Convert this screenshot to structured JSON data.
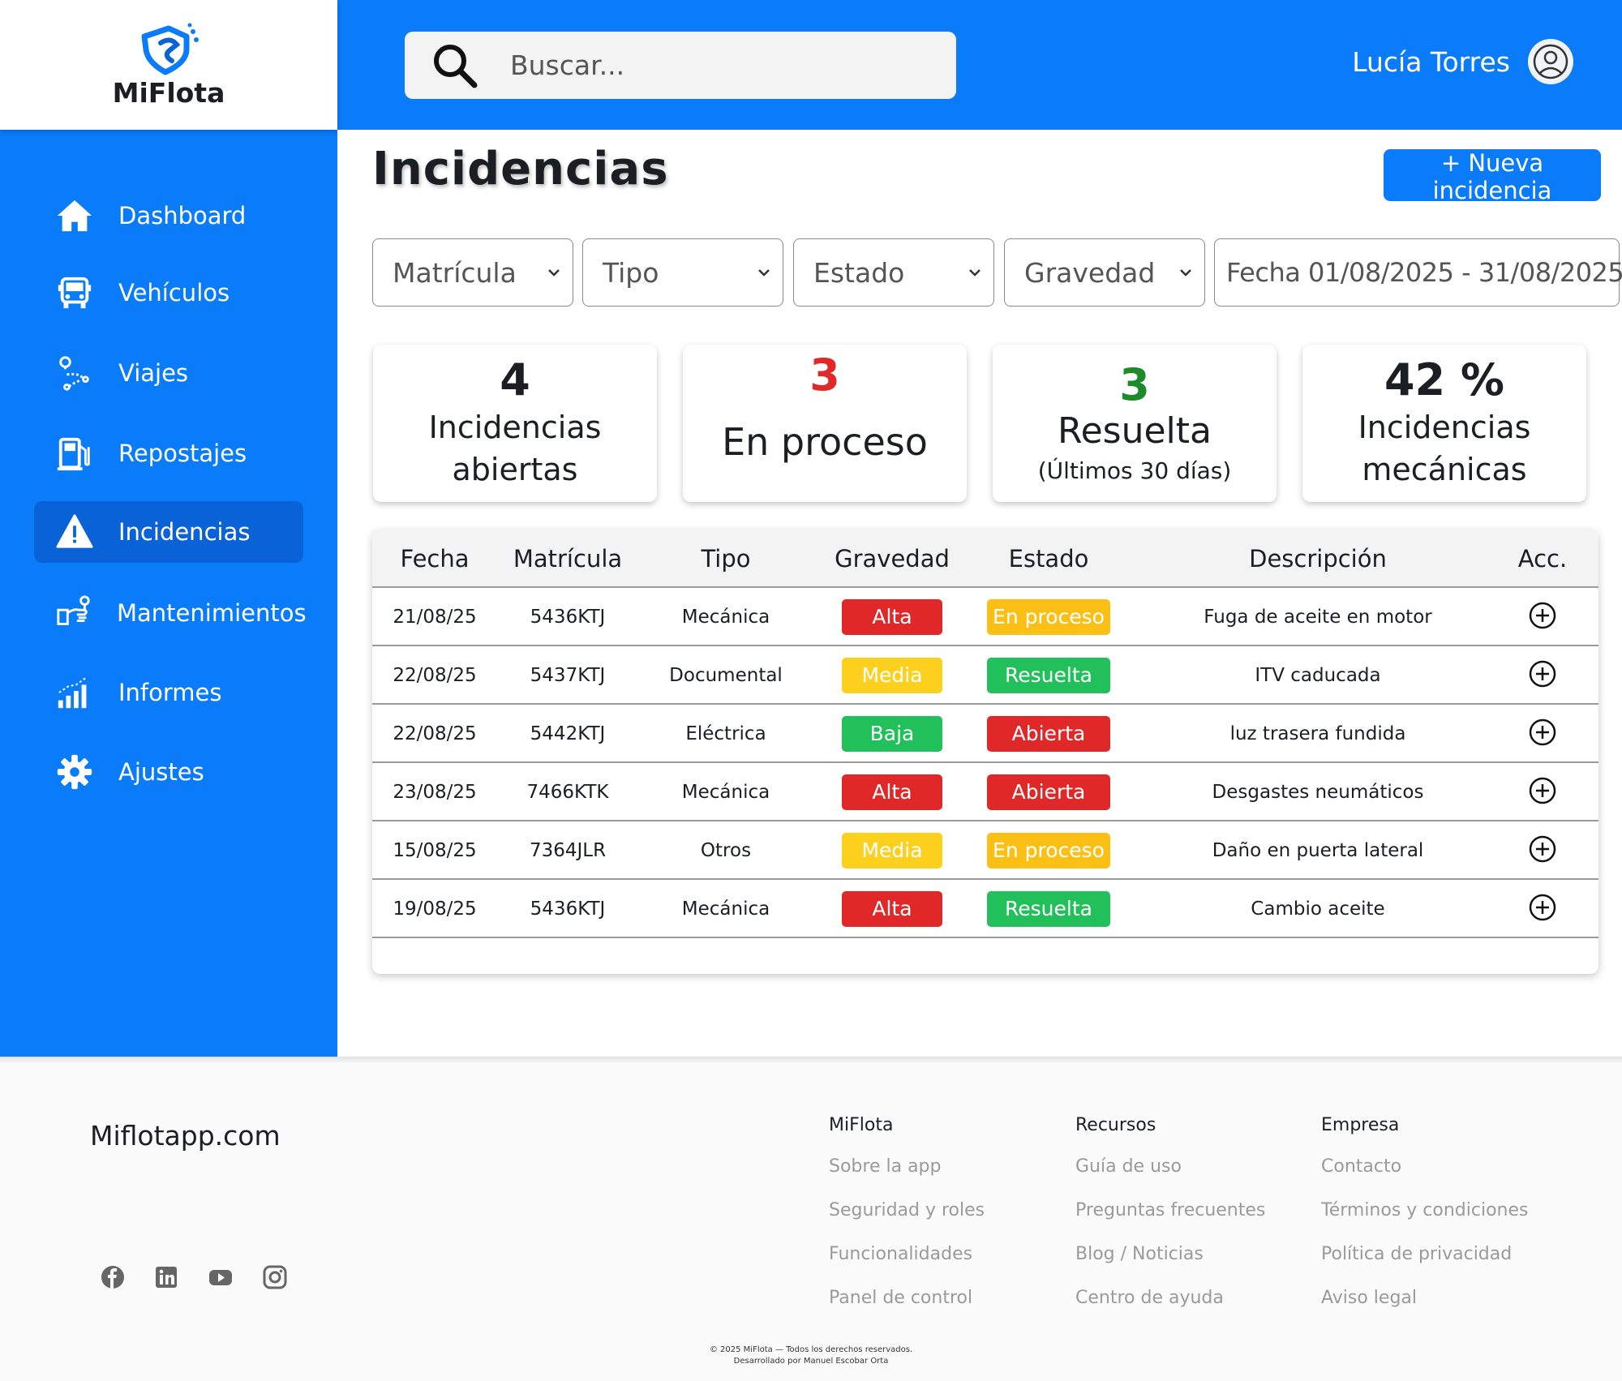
{
  "app": {
    "name": "MiFlota"
  },
  "colors": {
    "primary": "#0a7cf9",
    "active_nav": "#0a63d6",
    "red": "#e02828",
    "yellow": "#fcd01d",
    "green": "#21c05a",
    "orange": "#fbbf16"
  },
  "sidebar": {
    "items": [
      {
        "label": "Dashboard",
        "icon": "home-icon"
      },
      {
        "label": "Vehículos",
        "icon": "truck-icon"
      },
      {
        "label": "Viajes",
        "icon": "route-icon"
      },
      {
        "label": "Repostajes",
        "icon": "fuel-icon"
      },
      {
        "label": "Incidencias",
        "icon": "warning-icon",
        "active": true
      },
      {
        "label": "Mantenimientos",
        "icon": "wrench-icon"
      },
      {
        "label": "Informes",
        "icon": "bar-chart-icon"
      },
      {
        "label": "Ajustes",
        "icon": "gear-icon"
      }
    ]
  },
  "header": {
    "search_placeholder": "Buscar...",
    "user_name": "Lucía Torres"
  },
  "main": {
    "title": "Incidencias",
    "new_button": "+ Nueva incidencia",
    "filters": [
      "Matrícula",
      "Tipo",
      "Estado",
      "Gravedad",
      "Fecha 01/08/2025 - 31/08/2025"
    ]
  },
  "stats": [
    {
      "value": "4",
      "label1": "Incidencias",
      "label2": "abiertas"
    },
    {
      "value": "3",
      "label1": "En proceso"
    },
    {
      "value": "3",
      "label1": "Resuelta",
      "sub": "(Últimos 30 días)"
    },
    {
      "value": "42 %",
      "label1": "Incidencias",
      "label2": "mecánicas"
    }
  ],
  "table": {
    "headers": [
      "Fecha",
      "Matrícula",
      "Tipo",
      "Gravedad",
      "Estado",
      "Descripción",
      "Acc."
    ],
    "rows": [
      {
        "fecha": "21/08/25",
        "matricula": "5436KTJ",
        "tipo": "Mecánica",
        "gravedad": "Alta",
        "estado": "En proceso",
        "descripcion": "Fuga de aceite en motor"
      },
      {
        "fecha": "22/08/25",
        "matricula": "5437KTJ",
        "tipo": "Documental",
        "gravedad": "Media",
        "estado": "Resuelta",
        "descripcion": "ITV caducada"
      },
      {
        "fecha": "22/08/25",
        "matricula": "5442KTJ",
        "tipo": "Eléctrica",
        "gravedad": "Baja",
        "estado": "Abierta",
        "descripcion": "luz trasera fundida"
      },
      {
        "fecha": "23/08/25",
        "matricula": "7466KTK",
        "tipo": "Mecánica",
        "gravedad": "Alta",
        "estado": "Abierta",
        "descripcion": "Desgastes neumáticos"
      },
      {
        "fecha": "15/08/25",
        "matricula": "7364JLR",
        "tipo": "Otros",
        "gravedad": "Media",
        "estado": "En proceso",
        "descripcion": "Daño en puerta lateral"
      },
      {
        "fecha": "19/08/25",
        "matricula": "5436KTJ",
        "tipo": "Mecánica",
        "gravedad": "Alta",
        "estado": "Resuelta",
        "descripcion": "Cambio aceite"
      }
    ]
  },
  "footer": {
    "site": "Miflotapp.com",
    "columns": [
      {
        "title": "MiFlota",
        "links": [
          "Sobre la app",
          "Seguridad y roles",
          "Funcionalidades",
          "Panel de control"
        ]
      },
      {
        "title": "Recursos",
        "links": [
          "Guía de uso",
          "Preguntas frecuentes",
          "Blog / Noticias",
          "Centro de ayuda"
        ]
      },
      {
        "title": "Empresa",
        "links": [
          "Contacto",
          "Términos y condiciones",
          "Política de privacidad",
          "Aviso legal"
        ]
      }
    ],
    "social": [
      "facebook-icon",
      "linkedin-icon",
      "youtube-icon",
      "instagram-icon"
    ],
    "copyright": "© 2025 MiFlota — Todos los derechos reservados.",
    "credit": "Desarrollado por Manuel Escobar Orta"
  }
}
